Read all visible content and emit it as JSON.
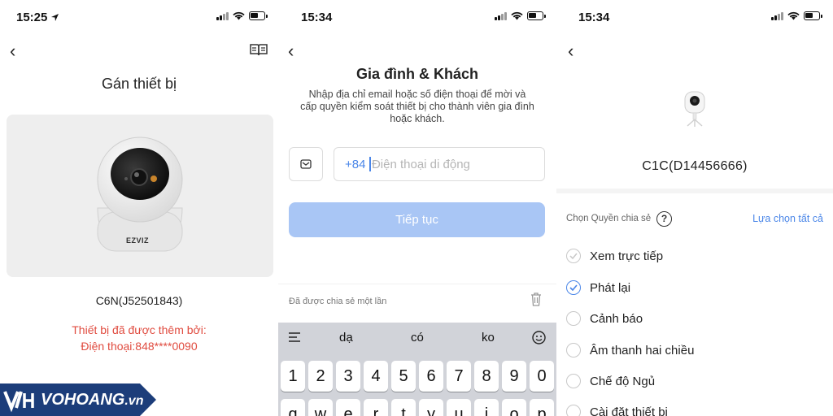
{
  "panel1": {
    "time": "15:25",
    "title": "Gán thiết bị",
    "camera_brand": "EZVIZ",
    "device_name": "C6N(J52501843)",
    "added_by_line1": "Thiết bị đã được thêm bởi:",
    "added_by_line2": "Điện thoại:848****0090"
  },
  "panel2": {
    "time": "15:34",
    "title": "Gia đình & Khách",
    "description": "Nhập địa chỉ email hoặc số điện thoại để mời và cấp quyền kiểm soát thiết bị cho thành viên gia đình hoặc khách.",
    "country_code": "+84",
    "phone_placeholder": "Điện thoại di động",
    "continue_label": "Tiếp tục",
    "shared_once": "Đã được chia sẻ một lần",
    "suggestions": [
      "dạ",
      "có",
      "ko"
    ],
    "number_keys": [
      "1",
      "2",
      "3",
      "4",
      "5",
      "6",
      "7",
      "8",
      "9",
      "0"
    ],
    "letter_keys": [
      "q",
      "w",
      "e",
      "r",
      "t",
      "y",
      "u",
      "i",
      "o",
      "p"
    ]
  },
  "panel3": {
    "time": "15:34",
    "device_name": "C1C(D14456666)",
    "choose_permission": "Chọn Quyền chia sẻ",
    "help": "?",
    "select_all": "Lựa chọn tất cả",
    "permissions": [
      {
        "label": "Xem trực tiếp",
        "checked": false
      },
      {
        "label": "Phát lại",
        "checked": true
      },
      {
        "label": "Cảnh báo",
        "checked": false
      },
      {
        "label": "Âm thanh hai chiều",
        "checked": false
      },
      {
        "label": "Chế độ Ngủ",
        "checked": false
      },
      {
        "label": "Cài đặt thiết bị",
        "checked": false
      }
    ]
  },
  "watermark": {
    "brand": "VOHOANG",
    "suffix": ".vn"
  },
  "colors": {
    "accent": "#4a86e8",
    "alert": "#e04b3f",
    "button_disabled": "#a9c6f5",
    "watermark_bg": "#1c3d7a"
  }
}
